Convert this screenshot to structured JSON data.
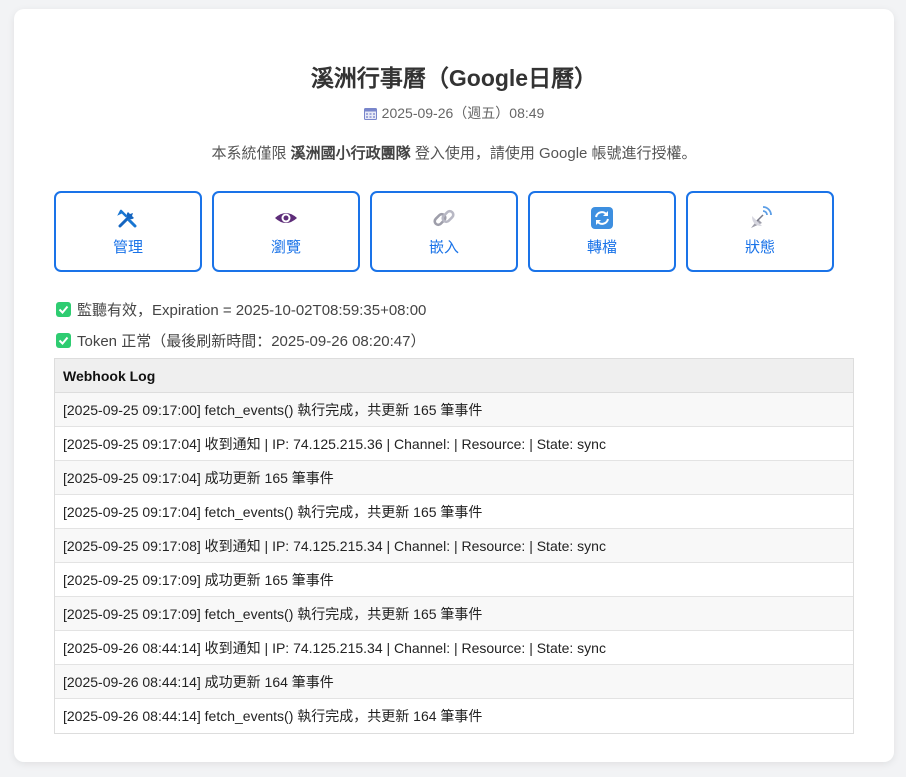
{
  "header": {
    "title": "溪洲行事曆（Google日曆）",
    "date": "2025-09-26（週五）08:49",
    "notice_prefix": "本系統僅限",
    "notice_org": "溪洲國小行政團隊",
    "notice_suffix": "登入使用，請使用 Google 帳號進行授權。"
  },
  "buttons": [
    {
      "label": "管理",
      "icon": "tools-icon"
    },
    {
      "label": "瀏覽",
      "icon": "eye-icon"
    },
    {
      "label": "嵌入",
      "icon": "link-icon"
    },
    {
      "label": "轉檔",
      "icon": "sync-icon"
    },
    {
      "label": "狀態",
      "icon": "satellite-icon"
    }
  ],
  "status": {
    "watch": "監聽有效，Expiration = 2025-10-02T08:59:35+08:00",
    "token": "Token 正常（最後刷新時間：2025-09-26 08:20:47）"
  },
  "log": {
    "title": "Webhook Log",
    "rows": [
      "[2025-09-25 09:17:00] fetch_events() 執行完成，共更新 165 筆事件",
      "[2025-09-25 09:17:04] 收到通知 | IP: 74.125.215.36 | Channel: | Resource: | State: sync",
      "[2025-09-25 09:17:04] 成功更新 165 筆事件",
      "[2025-09-25 09:17:04] fetch_events() 執行完成，共更新 165 筆事件",
      "[2025-09-25 09:17:08] 收到通知 | IP: 74.125.215.34 | Channel: | Resource: | State: sync",
      "[2025-09-25 09:17:09] 成功更新 165 筆事件",
      "[2025-09-25 09:17:09] fetch_events() 執行完成，共更新 165 筆事件",
      "[2025-09-26 08:44:14] 收到通知 | IP: 74.125.215.34 | Channel: | Resource: | State: sync",
      "[2025-09-26 08:44:14] 成功更新 164 筆事件",
      "[2025-09-26 08:44:14] fetch_events() 執行完成，共更新 164 筆事件"
    ]
  },
  "colors": {
    "accent": "#1a73e8",
    "check": "#2ecc71"
  }
}
